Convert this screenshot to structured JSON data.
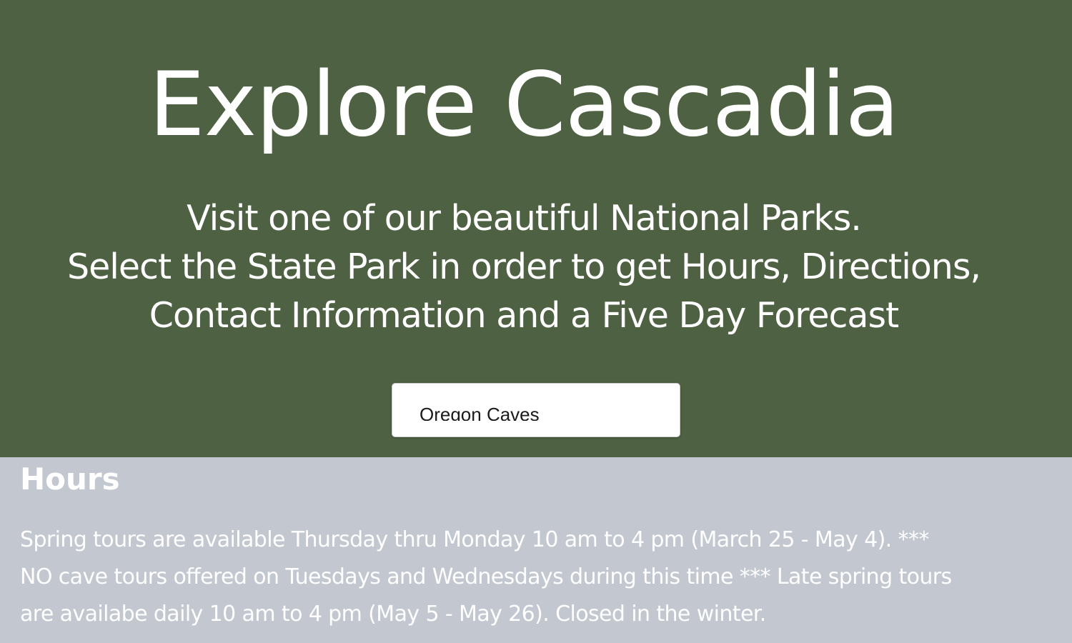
{
  "hero": {
    "title": "Explore Cascadia",
    "subtitle_lines": [
      "Visit one of our beautiful National Parks.",
      "Select the State Park in order to get Hours, Directions,",
      "Contact Information and a Five Day Forecast"
    ],
    "park_select": {
      "selected": "Oregon Caves"
    }
  },
  "hours": {
    "heading": "Hours",
    "text_lines": [
      "Spring tours are available Thursday thru Monday 10 am to 4 pm (March 25 - May 4). ***",
      "NO cave tours offered on Tuesdays and Wednesdays during this time *** Late spring tours",
      "are availabe daily 10 am to 4 pm (May 5 - May 26). Closed in the winter."
    ]
  },
  "colors": {
    "hero_background": "#4e6142",
    "info_background": "#c2c7d0",
    "text": "#ffffff"
  }
}
